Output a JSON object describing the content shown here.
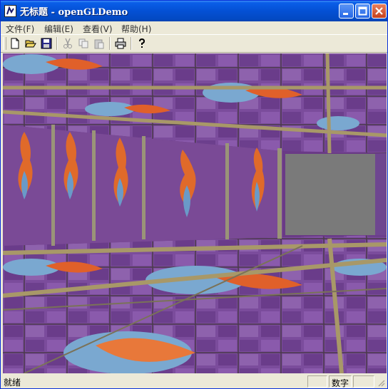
{
  "window": {
    "title": "无标题 - openGLDemo"
  },
  "menu": [
    {
      "label": "文件(F)"
    },
    {
      "label": "编辑(E)"
    },
    {
      "label": "查看(V)"
    },
    {
      "label": "帮助(H)"
    }
  ],
  "toolbar": {
    "buttons": [
      "new-icon",
      "open-icon",
      "save-icon",
      "cut-icon",
      "copy-icon",
      "paste-icon",
      "print-icon",
      "help-icon"
    ]
  },
  "status": {
    "text": "就绪",
    "num_indicator": "数字"
  },
  "colors": {
    "titlebar": "#0450d4",
    "window_bg": "#ece9d8",
    "glass_purple": "#7a4a9a",
    "gray_wall": "#7a7a7a"
  }
}
